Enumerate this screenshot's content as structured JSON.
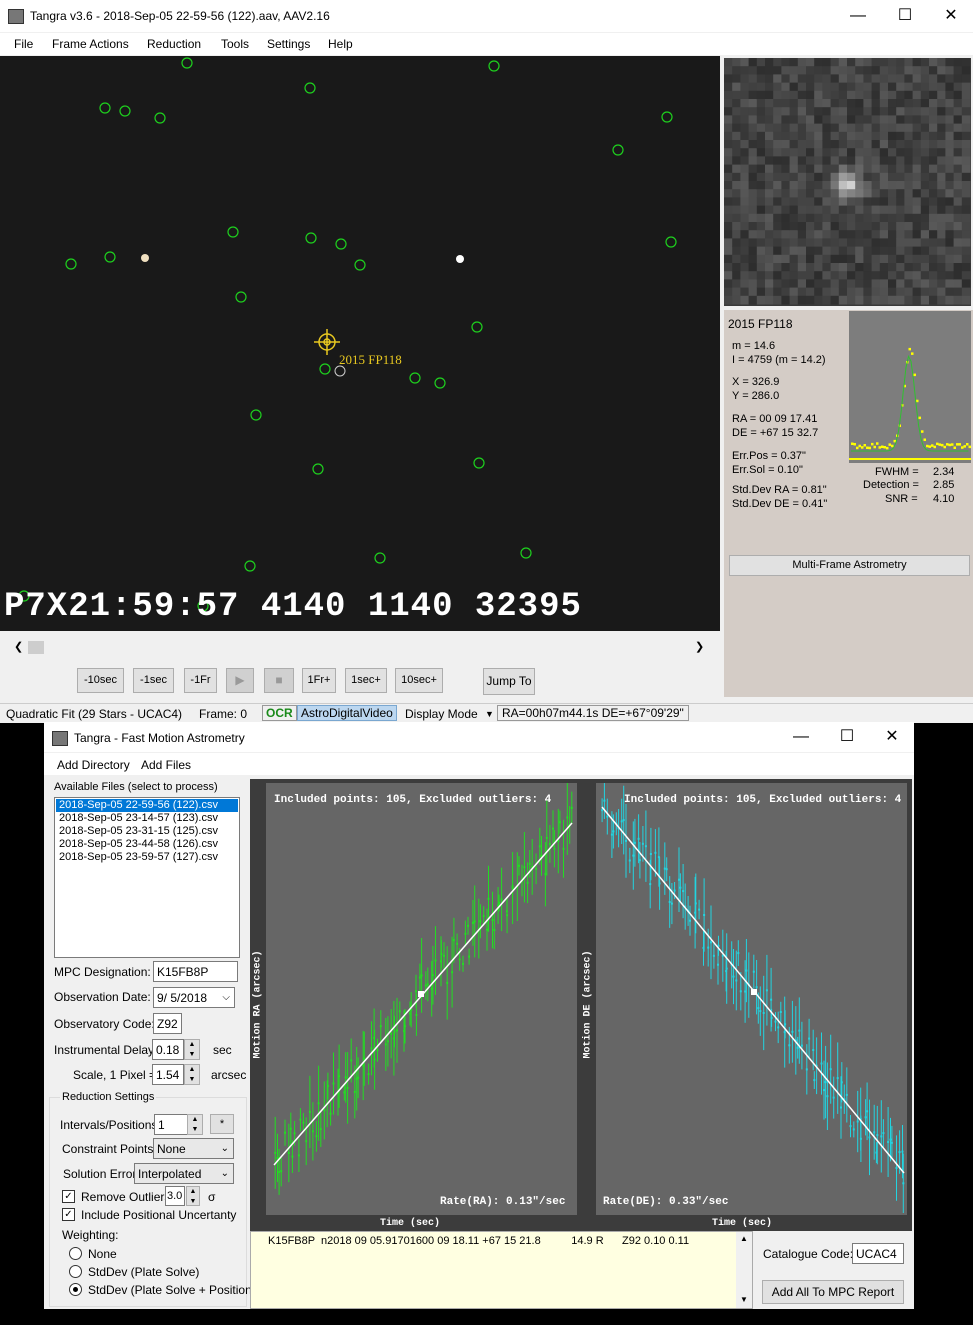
{
  "main": {
    "title": "Tangra v3.6 - 2018-Sep-05 22-59-56 (122).aav, AAV2.16",
    "menu": [
      "File",
      "Frame Actions",
      "Reduction",
      "Tools",
      "Settings",
      "Help"
    ],
    "video": {
      "target_label": "2015 FP118",
      "osd_text": "P7X21:59:57 4140 1140 32395"
    },
    "object_info": {
      "name": "2015 FP118",
      "m": "m = 14.6",
      "I": "I =  4759 (m = 14.2)",
      "X": "X =    326.9",
      "Y": "Y =    286.0",
      "RA": "RA =   00 09 17.41",
      "DE": "DE =  +67 15 32.7",
      "err_pos": "Err.Pos = 0.37\"",
      "err_sol": "Err.Sol =  0.10\"",
      "std_ra": "Std.Dev RA = 0.81\"",
      "std_de": "Std.Dev DE = 0.41\"",
      "fwhm_label": "FWHM =",
      "fwhm": "2.34",
      "detection_label": "Detection =",
      "detection": "2.85",
      "snr_label": "SNR =",
      "snr": "4.10",
      "multi_frame_button": "Multi-Frame Astrometry"
    },
    "controls": [
      "-10sec",
      "-1sec",
      "-1Fr",
      "",
      "",
      "1Fr+",
      "1sec+",
      "10sec+"
    ],
    "jump_to": "Jump To",
    "status": {
      "fit": "Quadratic Fit (29 Stars - UCAC4)",
      "frame": "Frame: 0",
      "ocr": "OCR",
      "video_type": "AstroDigitalVideo",
      "display_mode": "Display Mode",
      "coords": "RA=00h07m44.1s DE=+67°09'29\""
    }
  },
  "fma": {
    "title": "Tangra - Fast Motion Astrometry",
    "menu": [
      "Add Directory",
      "Add Files"
    ],
    "files_label": "Available Files (select to process)",
    "files": [
      "2018-Sep-05 22-59-56 (122).csv",
      "2018-Sep-05 23-14-57 (123).csv",
      "2018-Sep-05 23-31-15 (125).csv",
      "2018-Sep-05 23-44-58 (126).csv",
      "2018-Sep-05 23-59-57 (127).csv"
    ],
    "mpc_designation_label": "MPC Designation:",
    "mpc_designation": "K15FB8P",
    "observation_date_label": "Observation Date:",
    "observation_date": "9/ 5/2018",
    "observatory_code_label": "Observatory Code:",
    "observatory_code": "Z92",
    "instrumental_delay_label": "Instrumental Delay:",
    "instrumental_delay": "0.18",
    "delay_unit": "sec",
    "scale_label": "Scale, 1 Pixel =",
    "scale": "1.54",
    "scale_unit": "arcsec",
    "reduction_settings_label": "Reduction Settings",
    "intervals_label": "Intervals/Positions:",
    "intervals": "1",
    "star_btn": "*",
    "constraint_label": "Constraint Points:",
    "constraint": "None",
    "solution_error_label": "Solution Error:",
    "solution_error": "Interpolated",
    "remove_outliers_label": "Remove Outliers",
    "outliers_value": "3.0",
    "sigma": "σ",
    "include_uncertainty_label": "Include Positional Uncertanty",
    "weighting_label": "Weighting:",
    "weighting_options": [
      "None",
      "StdDev (Plate Solve)",
      "StdDev (Plate Solve + Position)"
    ],
    "plot_ra": {
      "header": "Included points: 105, Excluded outliers: 4",
      "ylabel": "Motion RA (arcsec)",
      "xlabel": "Time (sec)",
      "rate": "Rate(RA): 0.13\"/sec",
      "color": "#22dd22"
    },
    "plot_de": {
      "header": "Included points: 105, Excluded outliers: 4",
      "ylabel": "Motion DE (arcsec)",
      "xlabel": "Time (sec)",
      "rate": "Rate(DE): 0.33\"/sec",
      "color": "#22d4e0"
    },
    "report_line": "K15FB8P  n2018 09 05.91701600 09 18.11 +67 15 21.8          14.9 R      Z92 0.10 0.11",
    "catalogue_label": "Catalogue Code:",
    "catalogue": "UCAC4",
    "add_report_button": "Add All To MPC Report File"
  }
}
